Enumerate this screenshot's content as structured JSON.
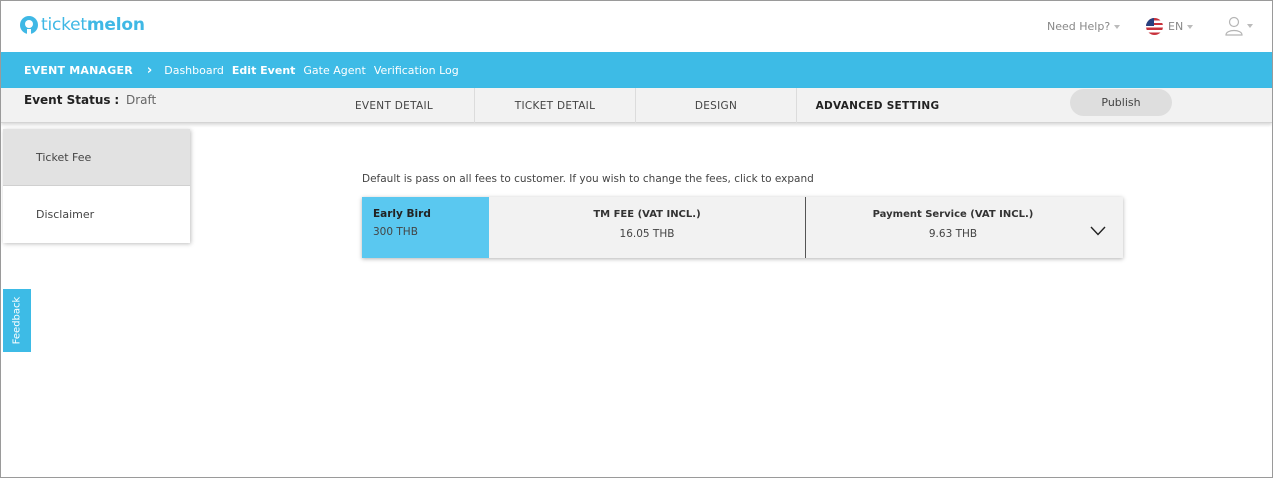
{
  "brand": {
    "logo_prefix": "ticket",
    "logo_suffix": "melon",
    "accent": "#3dbbe6"
  },
  "header": {
    "need_help": "Need Help?",
    "language": "EN",
    "icons": {
      "language_flag": "us-flag-icon",
      "user": "user-icon"
    }
  },
  "nav": {
    "section": "EVENT MANAGER",
    "items": [
      {
        "label": "Dashboard"
      },
      {
        "label": "Edit Event"
      },
      {
        "label": "Gate Agent"
      },
      {
        "label": "Verification Log"
      }
    ],
    "active": "Edit Event"
  },
  "status": {
    "label": "Event Status",
    "separator": ":",
    "value": "Draft"
  },
  "tabs": [
    {
      "label": "EVENT DETAIL"
    },
    {
      "label": "TICKET DETAIL"
    },
    {
      "label": "DESIGN"
    },
    {
      "label": "ADVANCED SETTING"
    }
  ],
  "active_tab": "ADVANCED SETTING",
  "publish_label": "Publish",
  "sidebar": {
    "items": [
      {
        "label": "Ticket Fee"
      },
      {
        "label": "Disclaimer"
      }
    ],
    "active": "Ticket Fee"
  },
  "feedback_label": "Feedback",
  "main": {
    "hint": "Default is pass on all fees to customer. If you wish to change the fees, click to expand",
    "fee_row": {
      "ticket_name": "Early Bird",
      "ticket_price": "300 THB",
      "tm_fee_header": "TM FEE (VAT INCL.)",
      "tm_fee_value": "16.05 THB",
      "payment_header": "Payment Service (VAT INCL.)",
      "payment_value": "9.63 THB"
    }
  }
}
